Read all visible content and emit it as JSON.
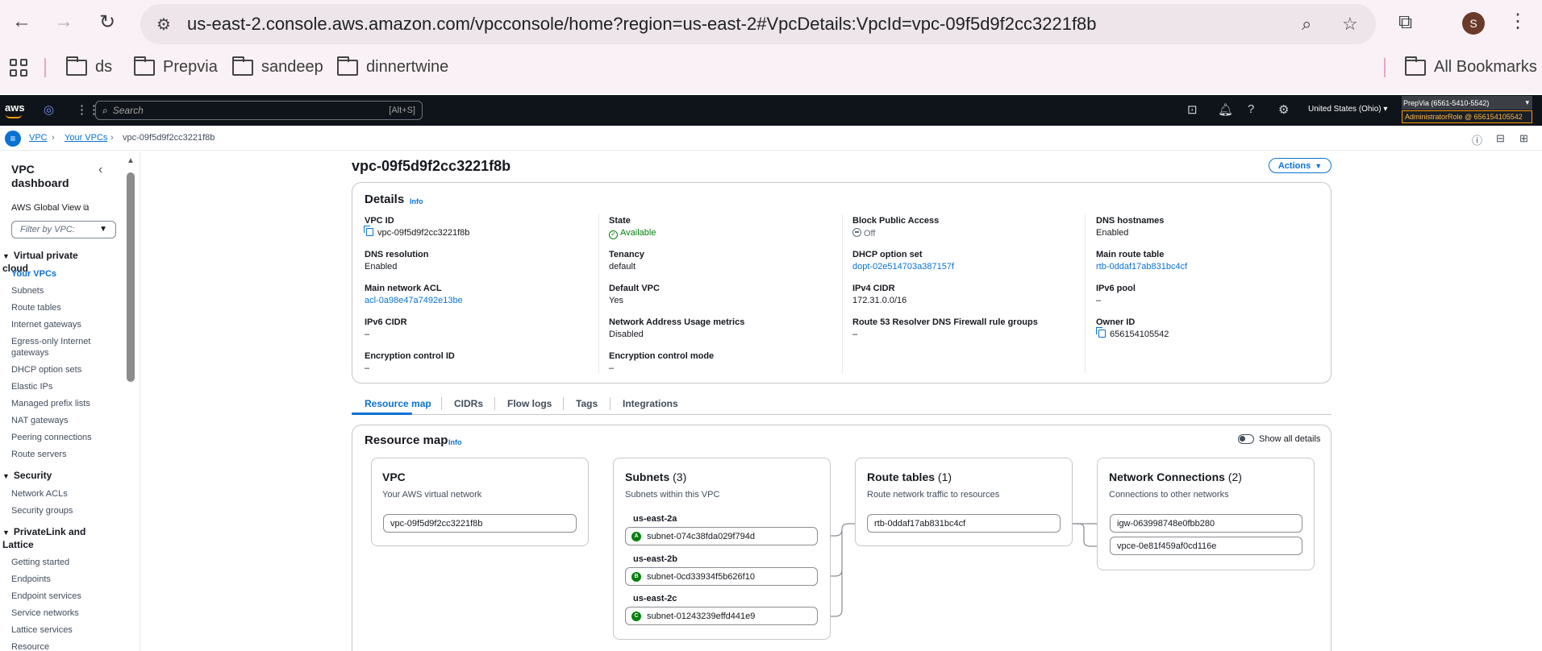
{
  "browser": {
    "url": "us-east-2.console.aws.amazon.com/vpcconsole/home?region=us-east-2#VpcDetails:VpcId=vpc-09f5d9f2cc3221f8b",
    "profile_initial": "S",
    "bookmarks": [
      "ds",
      "Prepvia",
      "sandeep",
      "dinnertwine"
    ],
    "all_bookmarks": "All Bookmarks"
  },
  "aws_nav": {
    "logo": "aws",
    "search_placeholder": "Search",
    "search_shortcut": "[Alt+S]",
    "region": "United States (Ohio) ▾",
    "account": "PrepVia (6561-5410-5542)",
    "role": "AdministratorRole @ 656154105542"
  },
  "breadcrumb": {
    "items": [
      "VPC",
      "Your VPCs"
    ],
    "current": "vpc-09f5d9f2cc3221f8b"
  },
  "sidebar": {
    "title": "VPC dashboard",
    "global_view": "AWS Global View",
    "filter_placeholder": "Filter by VPC:",
    "sections": {
      "vpc": "Virtual private cloud",
      "security": "Security",
      "privatelink": "PrivateLink and Lattice"
    },
    "vpc_items": [
      "Your VPCs",
      "Subnets",
      "Route tables",
      "Internet gateways",
      "Egress-only Internet gateways",
      "DHCP option sets",
      "Elastic IPs",
      "Managed prefix lists",
      "NAT gateways",
      "Peering connections",
      "Route servers"
    ],
    "security_items": [
      "Network ACLs",
      "Security groups"
    ],
    "privatelink_items": [
      "Getting started",
      "Endpoints",
      "Endpoint services",
      "Service networks",
      "Lattice services",
      "Resource configurations"
    ]
  },
  "page": {
    "title": "vpc-09f5d9f2cc3221f8b",
    "actions": "Actions"
  },
  "details": {
    "heading": "Details",
    "info": "Info",
    "fields": [
      {
        "label": "VPC ID",
        "value": "vpc-09f5d9f2cc3221f8b"
      },
      {
        "label": "State",
        "value": "Available"
      },
      {
        "label": "Block Public Access",
        "value": "Off"
      },
      {
        "label": "DNS hostnames",
        "value": "Enabled"
      },
      {
        "label": "DNS resolution",
        "value": "Enabled"
      },
      {
        "label": "Tenancy",
        "value": "default"
      },
      {
        "label": "DHCP option set",
        "value": "dopt-02e514703a387157f"
      },
      {
        "label": "Main route table",
        "value": "rtb-0ddaf17ab831bc4cf"
      },
      {
        "label": "Main network ACL",
        "value": "acl-0a98e47a7492e13be"
      },
      {
        "label": "Default VPC",
        "value": "Yes"
      },
      {
        "label": "IPv4 CIDR",
        "value": "172.31.0.0/16"
      },
      {
        "label": "IPv6 pool",
        "value": "–"
      },
      {
        "label": "IPv6 CIDR",
        "value": "–"
      },
      {
        "label": "Network Address Usage metrics",
        "value": "Disabled"
      },
      {
        "label": "Route 53 Resolver DNS Firewall rule groups",
        "value": "–"
      },
      {
        "label": "Owner ID",
        "value": "656154105542"
      },
      {
        "label": "Encryption control ID",
        "value": "–"
      },
      {
        "label": "Encryption control mode",
        "value": "–"
      }
    ]
  },
  "tabs": [
    "Resource map",
    "CIDRs",
    "Flow logs",
    "Tags",
    "Integrations"
  ],
  "resource_map": {
    "heading": "Resource map",
    "info": "Info",
    "toggle_label": "Show all details",
    "vpc": {
      "title": "VPC",
      "subtitle": "Your AWS virtual network",
      "id": "vpc-09f5d9f2cc3221f8b"
    },
    "subnets": {
      "title": "Subnets",
      "count": "(3)",
      "subtitle": "Subnets within this VPC",
      "zones": [
        {
          "az": "us-east-2a",
          "badge": "A",
          "subnet": "subnet-074c38fda029f794d"
        },
        {
          "az": "us-east-2b",
          "badge": "B",
          "subnet": "subnet-0cd33934f5b626f10"
        },
        {
          "az": "us-east-2c",
          "badge": "C",
          "subnet": "subnet-01243239effd441e9"
        }
      ]
    },
    "route_tables": {
      "title": "Route tables",
      "count": "(1)",
      "subtitle": "Route network traffic to resources",
      "id": "rtb-0ddaf17ab831bc4cf"
    },
    "network_connections": {
      "title": "Network Connections",
      "count": "(2)",
      "subtitle": "Connections to other networks",
      "items": [
        "igw-063998748e0fbb280",
        "vpce-0e81f459af0cd116e"
      ]
    }
  },
  "colors": {
    "accent": "#0972d3",
    "success": "#037f0c",
    "aws_nav_bg": "#0f141a",
    "aws_orange": "#ff9900"
  }
}
